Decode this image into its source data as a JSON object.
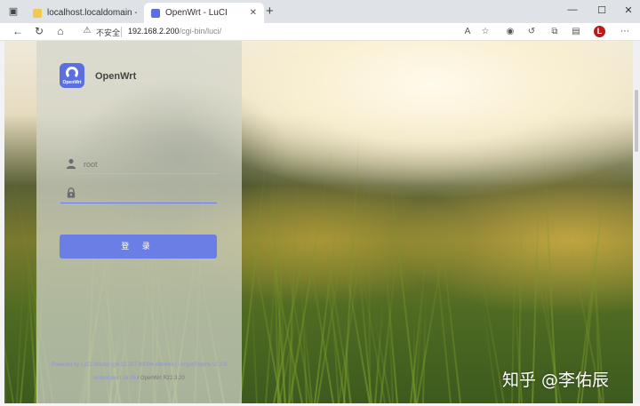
{
  "browser": {
    "tabs": [
      {
        "label": "localhost.localdomain - VMware",
        "favicon_color": "#f2c94c",
        "active": false
      },
      {
        "label": "OpenWrt - LuCI",
        "favicon_color": "#5b6fe0",
        "active": true
      }
    ],
    "new_tab_glyph": "+",
    "window_controls": [
      "—",
      "☐",
      "✕"
    ],
    "security_label": "不安全",
    "url_host": "192.168.2.200",
    "url_path": "/cgi-bin/luci/",
    "profile_initial": "L",
    "profile_color": "#b71c1c"
  },
  "login": {
    "brand": "OpenWrt",
    "logo_text": "OpenWrt",
    "logo_color": "#5b6fe0",
    "username_placeholder": "root",
    "password_placeholder": "",
    "submit_label": "登 录",
    "button_color": "#6a7ee6",
    "footer_line1": "Powered by LuCI Master (git-22.287.69009-e8b44fe) / ArgonTheme v2.2.9",
    "footer_line2_link": "immortalwrt 18.06",
    "footer_line2_rest": " / OpenWrt R22.3.20"
  },
  "watermark": "知乎 @李佑辰"
}
